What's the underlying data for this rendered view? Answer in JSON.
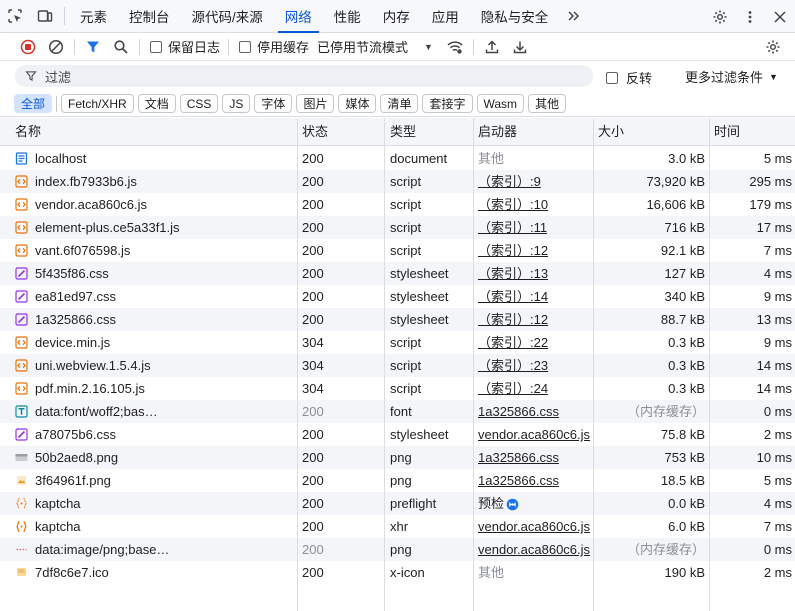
{
  "tabs": [
    {
      "label": "元素",
      "active": false
    },
    {
      "label": "控制台",
      "active": false
    },
    {
      "label": "源代码/来源",
      "active": false
    },
    {
      "label": "网络",
      "active": true
    },
    {
      "label": "性能",
      "active": false
    },
    {
      "label": "内存",
      "active": false
    },
    {
      "label": "应用",
      "active": false
    },
    {
      "label": "隐私与安全",
      "active": false
    }
  ],
  "toolbar": {
    "preserve_log_label": "保留日志",
    "disable_cache_label": "停用缓存",
    "throttle_value": "已停用节流模式"
  },
  "filter": {
    "placeholder": "过滤",
    "invert_label": "反转",
    "more_filters_label": "更多过滤条件"
  },
  "chips": [
    "全部",
    "Fetch/XHR",
    "文档",
    "CSS",
    "JS",
    "字体",
    "图片",
    "媒体",
    "清单",
    "套接字",
    "Wasm",
    "其他"
  ],
  "columns": {
    "name": "名称",
    "status": "状态",
    "type": "类型",
    "initiator": "启动器",
    "size": "大小",
    "time": "时间"
  },
  "rows": [
    {
      "icon": "document",
      "name": "localhost",
      "status": "200",
      "type": "document",
      "initiator": "其他",
      "initiator_style": "muted",
      "size": "3.0 kB",
      "size_style": "normal",
      "time": "5 ms"
    },
    {
      "icon": "script",
      "name": "index.fb7933b6.js",
      "status": "200",
      "type": "script",
      "initiator": "（索引）:9",
      "initiator_style": "link",
      "size": "73,920 kB",
      "size_style": "normal",
      "time": "295 ms"
    },
    {
      "icon": "script",
      "name": "vendor.aca860c6.js",
      "status": "200",
      "type": "script",
      "initiator": "（索引）:10",
      "initiator_style": "link",
      "size": "16,606 kB",
      "size_style": "normal",
      "time": "179 ms"
    },
    {
      "icon": "script",
      "name": "element-plus.ce5a33f1.js",
      "status": "200",
      "type": "script",
      "initiator": "（索引）:11",
      "initiator_style": "link",
      "size": "716 kB",
      "size_style": "normal",
      "time": "17 ms"
    },
    {
      "icon": "script",
      "name": "vant.6f076598.js",
      "status": "200",
      "type": "script",
      "initiator": "（索引）:12",
      "initiator_style": "link",
      "size": "92.1 kB",
      "size_style": "normal",
      "time": "7 ms"
    },
    {
      "icon": "stylesheet",
      "name": "5f435f86.css",
      "status": "200",
      "type": "stylesheet",
      "initiator": "（索引）:13",
      "initiator_style": "link",
      "size": "127 kB",
      "size_style": "normal",
      "time": "4 ms"
    },
    {
      "icon": "stylesheet",
      "name": "ea81ed97.css",
      "status": "200",
      "type": "stylesheet",
      "initiator": "（索引）:14",
      "initiator_style": "link",
      "size": "340 kB",
      "size_style": "normal",
      "time": "9 ms"
    },
    {
      "icon": "stylesheet",
      "name": "1a325866.css",
      "status": "200",
      "type": "stylesheet",
      "initiator": "（索引）:12",
      "initiator_style": "link",
      "size": "88.7 kB",
      "size_style": "normal",
      "time": "13 ms"
    },
    {
      "icon": "script",
      "name": "device.min.js",
      "status": "304",
      "type": "script",
      "initiator": "（索引）:22",
      "initiator_style": "link",
      "size": "0.3 kB",
      "size_style": "normal",
      "time": "9 ms"
    },
    {
      "icon": "script",
      "name": "uni.webview.1.5.4.js",
      "status": "304",
      "type": "script",
      "initiator": "（索引）:23",
      "initiator_style": "link",
      "size": "0.3 kB",
      "size_style": "normal",
      "time": "14 ms"
    },
    {
      "icon": "script",
      "name": "pdf.min.2.16.105.js",
      "status": "304",
      "type": "script",
      "initiator": "（索引）:24",
      "initiator_style": "link",
      "size": "0.3 kB",
      "size_style": "normal",
      "time": "14 ms"
    },
    {
      "icon": "font",
      "name": "data:font/woff2;bas…",
      "status": "200",
      "status_style": "muted",
      "type": "font",
      "initiator": "1a325866.css",
      "initiator_style": "link",
      "size": "（内存缓存）",
      "size_style": "muted",
      "time": "0 ms"
    },
    {
      "icon": "stylesheet",
      "name": "a78075b6.css",
      "status": "200",
      "type": "stylesheet",
      "initiator": "vendor.aca860c6.js",
      "initiator_style": "link",
      "size": "75.8 kB",
      "size_style": "normal",
      "time": "2 ms"
    },
    {
      "icon": "image",
      "name": "50b2aed8.png",
      "status": "200",
      "type": "png",
      "initiator": "1a325866.css",
      "initiator_style": "link",
      "size": "753 kB",
      "size_style": "normal",
      "time": "10 ms"
    },
    {
      "icon": "image-alt",
      "name": "3f64961f.png",
      "status": "200",
      "type": "png",
      "initiator": "1a325866.css",
      "initiator_style": "link",
      "size": "18.5 kB",
      "size_style": "normal",
      "time": "5 ms"
    },
    {
      "icon": "preflight",
      "name": "kaptcha",
      "status": "200",
      "type": "preflight",
      "initiator": "预检",
      "initiator_style": "preflight",
      "size": "0.0 kB",
      "size_style": "normal",
      "time": "4 ms"
    },
    {
      "icon": "xhr",
      "name": "kaptcha",
      "status": "200",
      "type": "xhr",
      "initiator": "vendor.aca860c6.js",
      "initiator_style": "link",
      "size": "6.0 kB",
      "size_style": "normal",
      "time": "7 ms"
    },
    {
      "icon": "data-image",
      "name": "data:image/png;base…",
      "status": "200",
      "status_style": "muted",
      "type": "png",
      "initiator": "vendor.aca860c6.js",
      "initiator_style": "link",
      "size": "（内存缓存）",
      "size_style": "muted",
      "time": "0 ms"
    },
    {
      "icon": "favicon",
      "name": "7df8c6e7.ico",
      "status": "200",
      "type": "x-icon",
      "initiator": "其他",
      "initiator_style": "muted",
      "size": "190 kB",
      "size_style": "normal",
      "time": "2 ms"
    }
  ],
  "colors": {
    "accent": "#0b57d0",
    "record": "#d93025",
    "document_icon": "#1a73e8",
    "script_icon": "#e8710a",
    "stylesheet_icon": "#9334e6",
    "font_icon": "#0f8ba0"
  }
}
